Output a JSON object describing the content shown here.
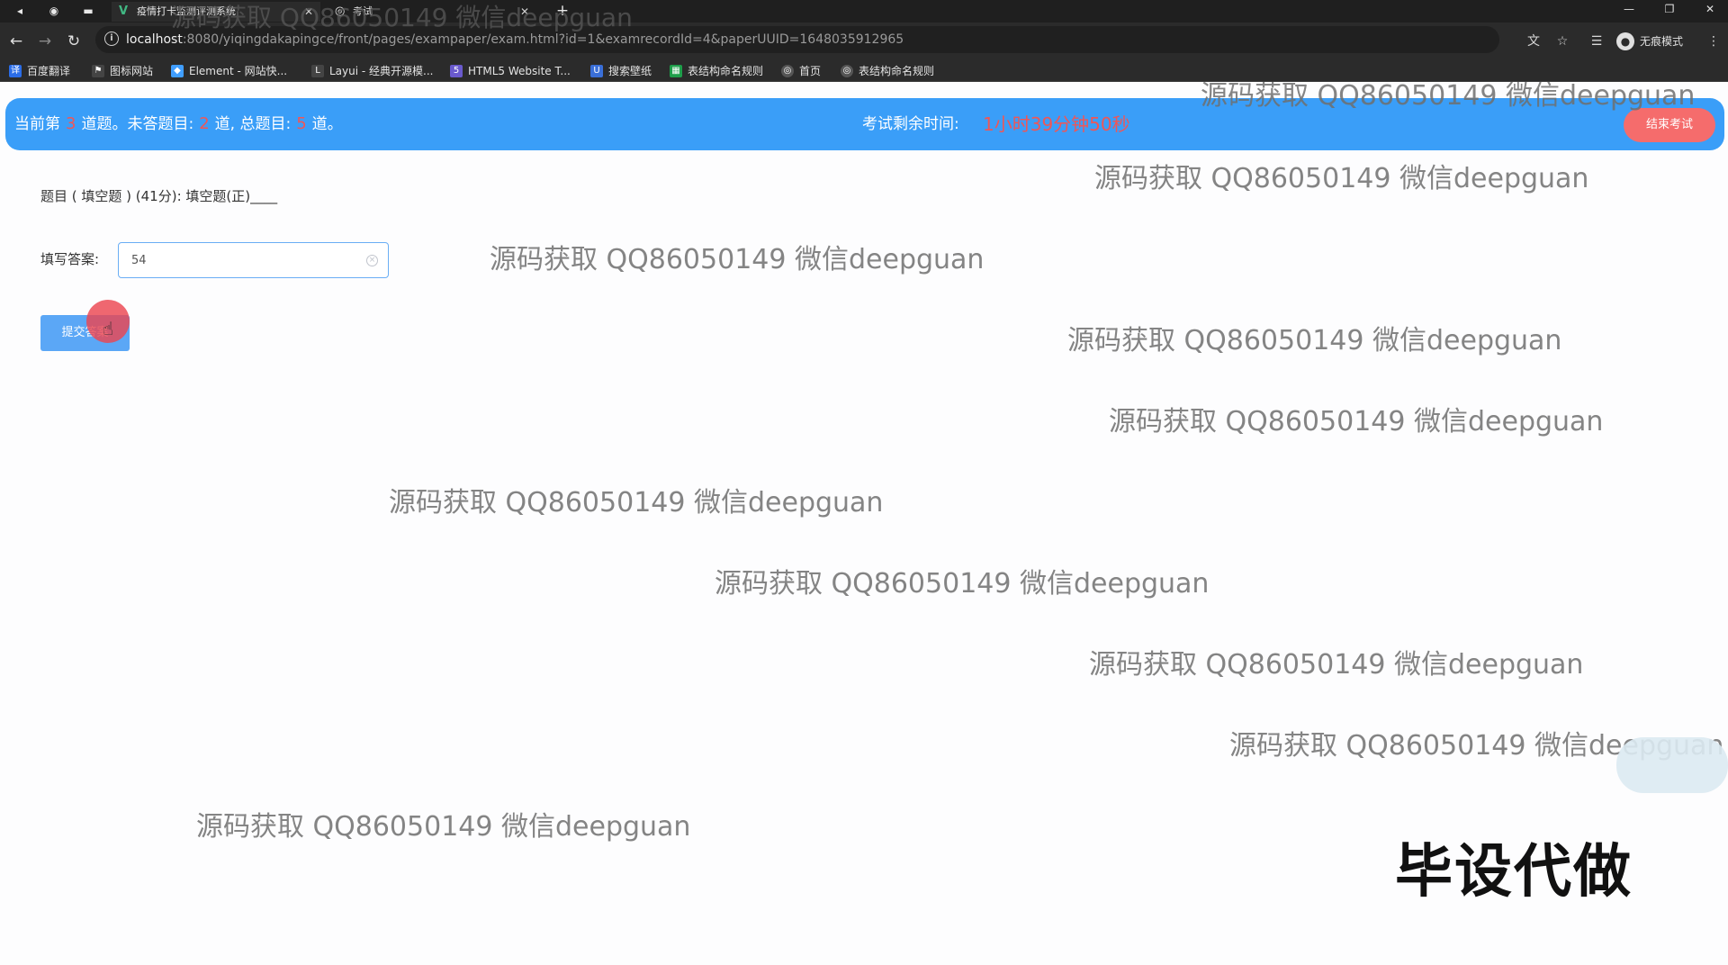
{
  "browser": {
    "tabs": [
      {
        "title": "疫情打卡监测评测系统",
        "icon": "vue-icon"
      },
      {
        "title": "考试",
        "icon": "globe-icon"
      }
    ],
    "url": {
      "host": "localhost",
      "rest": ":8080/yiqingdakapingce/front/pages/exampaper/exam.html?id=1&examrecordId=4&paperUUID=1648035912965"
    },
    "profile_label": "无痕模式",
    "bookmarks": [
      {
        "label": "百度翻译",
        "icon": "baidu-translate-icon",
        "color": "#2b6de8"
      },
      {
        "label": "图标网站",
        "icon": "flag-icon",
        "color": "#444444"
      },
      {
        "label": "Element - 网站快...",
        "icon": "element-icon",
        "color": "#409eff"
      },
      {
        "label": "Layui - 经典开源模...",
        "icon": "layui-icon",
        "color": "#444444"
      },
      {
        "label": "HTML5 Website T...",
        "icon": "html5-icon",
        "color": "#6a5acd"
      },
      {
        "label": "搜索壁纸",
        "icon": "wallpaper-icon",
        "color": "#3a6fd8"
      },
      {
        "label": "表结构命名规则",
        "icon": "sheet-icon",
        "color": "#1e9e4a"
      },
      {
        "label": "首页",
        "icon": "globe-icon",
        "color": "#555555"
      },
      {
        "label": "表结构命名规则",
        "icon": "globe-icon",
        "color": "#555555"
      }
    ]
  },
  "header": {
    "text_1": "当前第",
    "current": "3",
    "text_2": "道题。未答题目:",
    "unanswered": "2",
    "text_3": "道, 总题目:",
    "total": "5",
    "text_4": "道。",
    "timer_label": "考试剩余时间:",
    "timer_value": "1小时39分钟50秒",
    "end_button": "结束考试"
  },
  "question": {
    "text": "题目 ( 填空题 ) (41分):  填空题(正)____"
  },
  "answer": {
    "label": "填写答案:",
    "value": "54"
  },
  "submit_button": "提交答案",
  "watermark_text": "源码获取 QQ86050149 微信deepguan",
  "promo_text": "毕设代做",
  "colors": {
    "header_bg": "#3a9ef8",
    "accent_red": "#f05656",
    "end_button_bg": "#f56c6c",
    "submit_button_bg": "#5ba7f6"
  }
}
